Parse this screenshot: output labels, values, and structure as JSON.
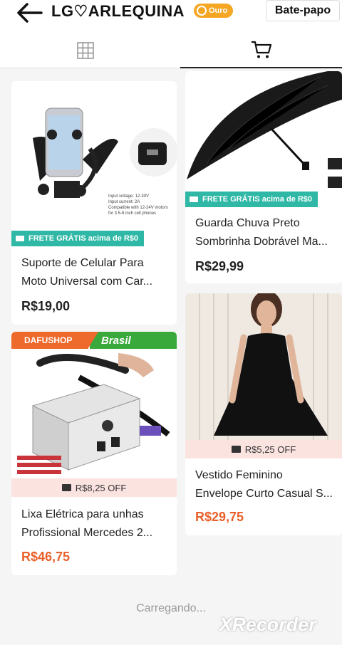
{
  "header": {
    "shop_name": "LG♡ARLEQUINA",
    "badge_label": "Ouro",
    "chat_label": "Bate-papo"
  },
  "products": [
    {
      "shipping_tag": "FRETE GRÁTIS acima de R$0",
      "title_line1": "Suporte de Celular Para",
      "title_line2": "Moto Universal com Car...",
      "price": "R$19,00",
      "image_caption1": "Input voltage: 12-30V",
      "image_caption2": "Input current: 2A",
      "image_caption3": "Compatible with 12-24V motors",
      "image_caption4": "for 3.5-6 inch cell phones"
    },
    {
      "shipping_tag": "FRETE GRÁTIS acima de R$0",
      "title_line1": "Guarda Chuva  Preto",
      "title_line2": "Sombrinha Dobrável Ma...",
      "price": "R$29,99"
    },
    {
      "banner_shop": "DAFUSHOP",
      "banner_country": "Brasil",
      "discount_tag": "R$8,25 OFF",
      "title_line1": "Lixa Elétrica para unhas",
      "title_line2": "Profissional Mercedes 2...",
      "price": "R$46,75"
    },
    {
      "discount_tag": "R$5,25 OFF",
      "title_line1": "Vestido Feminino",
      "title_line2": "Envelope Curto Casual S...",
      "price": "R$29,75"
    }
  ],
  "status": {
    "loading_text": "Carregando..."
  },
  "overlay": {
    "watermark": "XRecorder"
  },
  "colors": {
    "accent_orange": "#e8612c",
    "free_shipping_teal": "#2fb8a5",
    "gold_badge": "#f5a623",
    "discount_band": "#fbe3e0"
  }
}
